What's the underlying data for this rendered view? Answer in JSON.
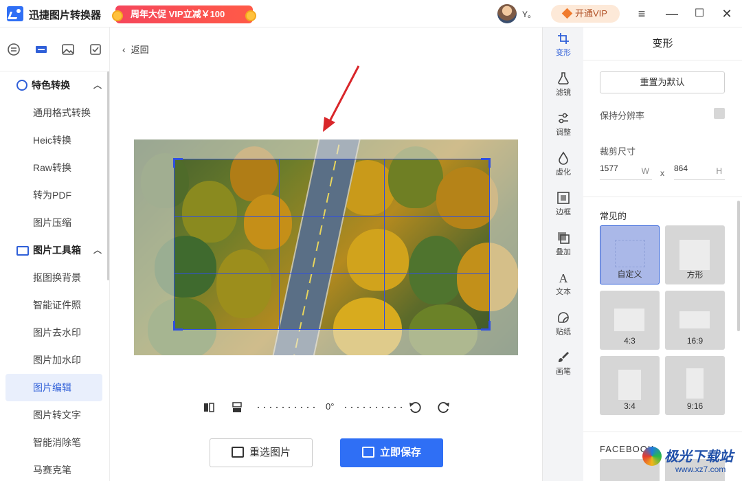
{
  "app": {
    "title": "迅捷图片转换器",
    "promo": "周年大促 VIP立减￥100",
    "username": "Y。",
    "vip_button": "开通VIP"
  },
  "sidebar": {
    "group1": "特色转换",
    "group1_items": [
      "通用格式转换",
      "Heic转换",
      "Raw转换",
      "转为PDF",
      "图片压缩"
    ],
    "group2": "图片工具箱",
    "group2_items": [
      "抠图换背景",
      "智能证件照",
      "图片去水印",
      "图片加水印",
      "图片编辑",
      "图片转文字",
      "智能消除笔",
      "马赛克笔"
    ],
    "active_item": "图片编辑"
  },
  "main": {
    "back": "返回",
    "angle": "0°",
    "reselect_button": "重选图片",
    "save_button": "立即保存"
  },
  "rail": {
    "items": [
      "变形",
      "滤镜",
      "调整",
      "虚化",
      "边框",
      "叠加",
      "文本",
      "贴纸",
      "画笔"
    ],
    "active": "变形"
  },
  "panel": {
    "title": "变形",
    "reset_button": "重置为默认",
    "keep_resolution": "保持分辨率",
    "crop_size_label": "裁剪尺寸",
    "width_value": "1577",
    "width_unit": "W",
    "separator": "x",
    "height_value": "864",
    "height_unit": "H",
    "common_label": "常见的",
    "presets": [
      "自定义",
      "方形",
      "4:3",
      "16:9",
      "3:4",
      "9:16"
    ],
    "selected_preset": "自定义",
    "facebook_label": "FACEBOOK"
  },
  "watermark": {
    "brand": "极光下载站",
    "url": "www.xz7.com"
  },
  "colors": {
    "accent": "#2f6ff5",
    "promo": "#f5465b",
    "crop_line": "#2f4fe0",
    "annotation_arrow": "#d9262a"
  }
}
